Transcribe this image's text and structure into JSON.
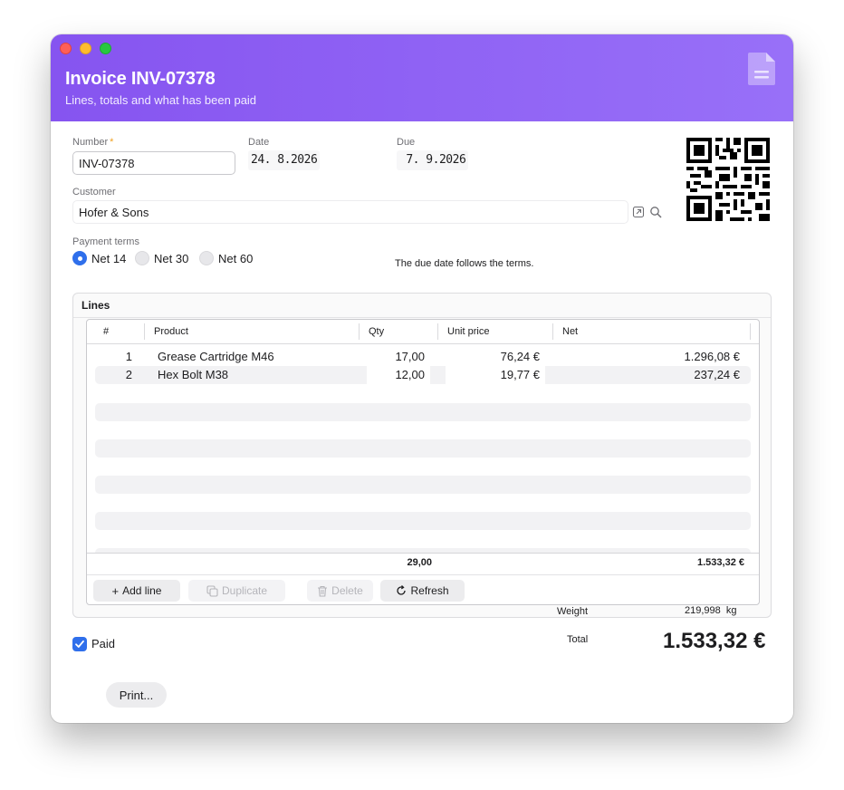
{
  "window": {
    "title": "Invoice INV-07378",
    "subtitle": "Lines, totals and what has been paid",
    "accent_color": "#8654f0",
    "header_icon": "document-icon"
  },
  "form": {
    "number_label": "Number",
    "number_required_mark": "*",
    "number_value": "INV-07378",
    "date_label": "Date",
    "date_value": "24. 8.2026",
    "due_label": "Due",
    "due_value": " 7. 9.2026",
    "customer_label": "Customer",
    "customer_value": "Hofer & Sons",
    "terms_label": "Payment terms",
    "terms_options": [
      "Net 14",
      "Net 30",
      "Net 60"
    ],
    "terms_selected": "Net 14",
    "terms_hint": "The due date follows the terms."
  },
  "lines": {
    "title": "Lines",
    "columns": [
      "#",
      "Product",
      "Qty",
      "Unit price",
      "Net"
    ],
    "rows": [
      {
        "num": "1",
        "product": "Grease Cartridge M46",
        "qty": "17,00",
        "unit_price": "76,24 €",
        "net": "1.296,08 €"
      },
      {
        "num": "2",
        "product": "Hex Bolt M38",
        "qty": "12,00",
        "unit_price": "19,77 €",
        "net": "237,24 €"
      }
    ],
    "footer_qty": "29,00",
    "footer_net": "1.533,32 €",
    "buttons": {
      "add": "Add line",
      "duplicate": "Duplicate",
      "delete": "Delete",
      "refresh": "Refresh"
    }
  },
  "summary": {
    "weight_label": "Weight",
    "weight_value": "219,998  kg",
    "paid_label": "Paid",
    "paid_checked": true,
    "total_label": "Total",
    "total_value": "1.533,32 €"
  },
  "actions": {
    "print_label": "Print..."
  }
}
